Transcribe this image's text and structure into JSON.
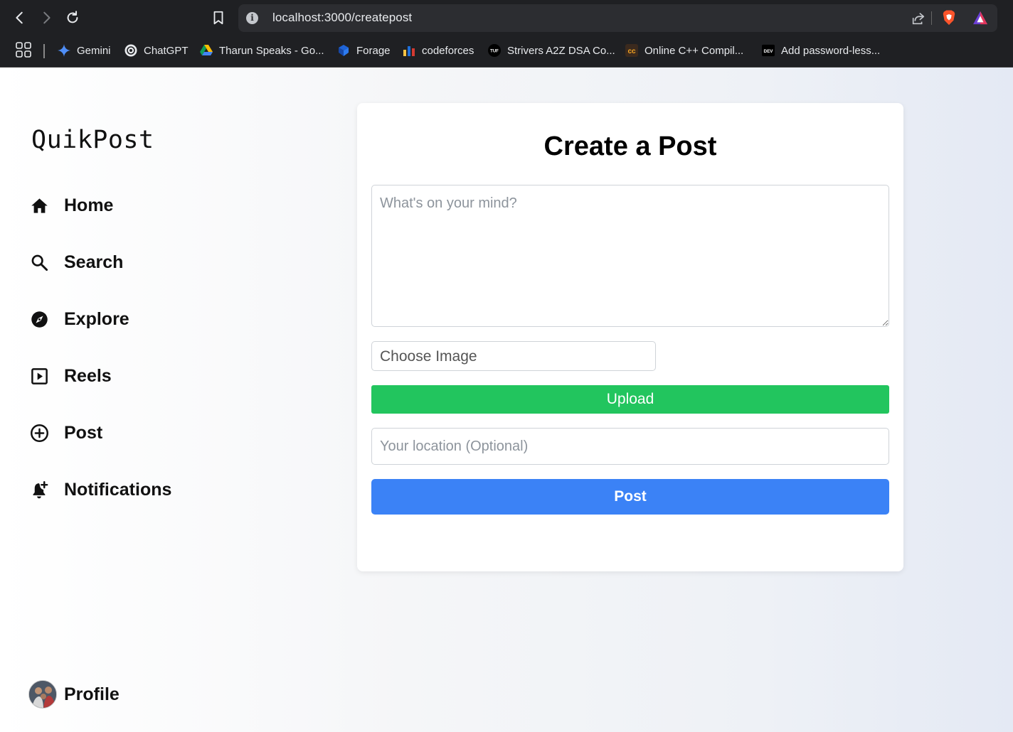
{
  "browser": {
    "url": "localhost:3000/createpost",
    "bookmarks": [
      {
        "label": "Gemini",
        "icon": "gemini-icon"
      },
      {
        "label": "ChatGPT",
        "icon": "chatgpt-icon"
      },
      {
        "label": "Tharun Speaks - Go...",
        "icon": "google-drive-icon"
      },
      {
        "label": "Forage",
        "icon": "forage-icon"
      },
      {
        "label": "codeforces",
        "icon": "codeforces-icon"
      },
      {
        "label": "Strivers A2Z DSA Co...",
        "icon": "tuf-icon"
      },
      {
        "label": "Online C++ Compil...",
        "icon": "cc-icon"
      },
      {
        "label": "Add password-less...",
        "icon": "dev-icon"
      }
    ]
  },
  "sidebar": {
    "logo": "QuikPost",
    "items": [
      {
        "label": "Home",
        "icon": "home-icon"
      },
      {
        "label": "Search",
        "icon": "search-icon"
      },
      {
        "label": "Explore",
        "icon": "compass-icon"
      },
      {
        "label": "Reels",
        "icon": "play-icon"
      },
      {
        "label": "Post",
        "icon": "plus-circle-icon"
      },
      {
        "label": "Notifications",
        "icon": "bell-plus-icon"
      }
    ],
    "profile_label": "Profile"
  },
  "form": {
    "title": "Create a Post",
    "content_placeholder": "What's on your mind?",
    "image_label": "Choose Image",
    "upload_label": "Upload",
    "location_placeholder": "Your location (Optional)",
    "submit_label": "Post"
  },
  "colors": {
    "upload": "#22c55e",
    "post": "#3b82f6"
  }
}
